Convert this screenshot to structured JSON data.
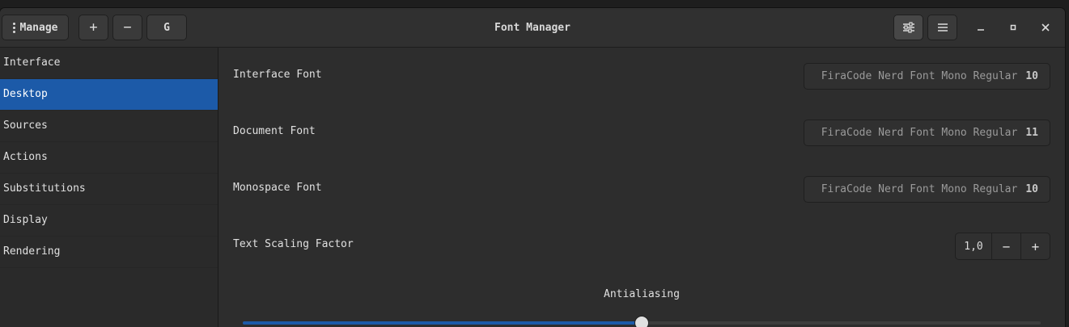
{
  "header": {
    "manage_label": "Manage",
    "add_label": "+",
    "remove_label": "−",
    "g_label": "G",
    "title": "Font Manager",
    "prefs_icon": "sliders-icon",
    "menu_icon": "hamburger-menu-icon"
  },
  "sidebar": {
    "items": [
      {
        "label": "Interface"
      },
      {
        "label": "Desktop"
      },
      {
        "label": "Sources"
      },
      {
        "label": "Actions"
      },
      {
        "label": "Substitutions"
      },
      {
        "label": "Display"
      },
      {
        "label": "Rendering"
      }
    ],
    "selected": "Desktop"
  },
  "desktop": {
    "interface_font": {
      "label": "Interface Font",
      "font": "FiraCode Nerd Font Mono Regular",
      "size": "10"
    },
    "document_font": {
      "label": "Document Font",
      "font": "FiraCode Nerd Font Mono Regular",
      "size": "11"
    },
    "monospace_font": {
      "label": "Monospace Font",
      "font": "FiraCode Nerd Font Mono Regular",
      "size": "10"
    },
    "scaling": {
      "label": "Text Scaling Factor",
      "value": "1,0",
      "minus": "−",
      "plus": "+"
    },
    "antialiasing": {
      "title": "Antialiasing",
      "level": 0.5
    }
  },
  "colors": {
    "accent": "#1c5aa8",
    "window_bg": "#2d2d2d",
    "sidebar_bg": "#2a2a2a"
  }
}
